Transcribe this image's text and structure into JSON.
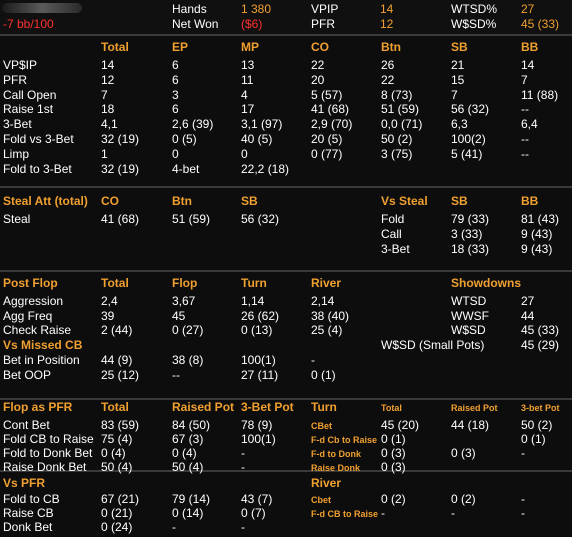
{
  "top": {
    "bb_per_100": "-7 bb/100",
    "hands_label": "Hands",
    "hands_value": "1 380",
    "netwon_label": "Net Won",
    "netwon_value": "($6)",
    "vpip_label": "VPIP",
    "vpip_value": "14",
    "pfr_label": "PFR",
    "pfr_value": "12",
    "wtsd_label": "WTSD%",
    "wtsd_value": "27",
    "wsd_label": "W$SD%",
    "wsd_value": "45 (33)"
  },
  "preflop": {
    "headers": [
      "Total",
      "EP",
      "MP",
      "CO",
      "Btn",
      "SB",
      "BB"
    ],
    "rows": [
      {
        "label": "VP$IP",
        "values": [
          "14",
          "6",
          "13",
          "22",
          "26",
          "21",
          "14"
        ]
      },
      {
        "label": "PFR",
        "values": [
          "12",
          "6",
          "11",
          "20",
          "22",
          "15",
          "7"
        ]
      },
      {
        "label": "Call Open",
        "values": [
          "7",
          "3",
          "4",
          "5 (57)",
          "8 (73)",
          "7",
          "11 (88)"
        ]
      },
      {
        "label": "Raise 1st",
        "values": [
          "18",
          "6",
          "17",
          "41 (68)",
          "51 (59)",
          "56 (32)",
          "--"
        ]
      },
      {
        "label": "3-Bet",
        "values": [
          "4,1",
          "2,6 (39)",
          "3,1 (97)",
          "2,9 (70)",
          "0,0 (71)",
          "6,3",
          "6,4"
        ]
      },
      {
        "label": "Fold vs 3-Bet",
        "values": [
          "32 (19)",
          "0 (5)",
          "40 (5)",
          "20 (5)",
          "50 (2)",
          "100(2)",
          "--"
        ]
      },
      {
        "label": "Limp",
        "values": [
          "1",
          "0",
          "0",
          "0 (77)",
          "3 (75)",
          "5 (41)",
          "--"
        ]
      },
      {
        "label": "Fold to 3-Bet",
        "values": [
          "32 (19)",
          "4-bet",
          "22,2 (18)",
          "",
          "",
          "",
          ""
        ]
      }
    ]
  },
  "steal": {
    "title": "Steal Att (total)",
    "headers": [
      "CO",
      "Btn",
      "SB"
    ],
    "row_label": "Steal",
    "row_values": [
      "41 (68)",
      "51 (59)",
      "56 (32)"
    ],
    "vs_title": "Vs Steal",
    "vs_headers": [
      "SB",
      "BB"
    ],
    "vs_rows": [
      {
        "label": "Fold",
        "values": [
          "79 (33)",
          "81 (43)"
        ]
      },
      {
        "label": "Call",
        "values": [
          "3 (33)",
          "9 (43)"
        ]
      },
      {
        "label": "3-Bet",
        "values": [
          "18 (33)",
          "9 (43)"
        ]
      }
    ]
  },
  "postflop": {
    "title": "Post Flop",
    "headers": [
      "Total",
      "Flop",
      "Turn",
      "River"
    ],
    "rows": [
      {
        "label": "Aggression",
        "values": [
          "2,4",
          "3,67",
          "1,14",
          "2,14"
        ]
      },
      {
        "label": "Agg Freq",
        "values": [
          "39",
          "45",
          "26 (62)",
          "38 (40)"
        ]
      },
      {
        "label": "Check Raise",
        "values": [
          "2 (44)",
          "0 (27)",
          "0 (13)",
          "25 (4)"
        ]
      }
    ],
    "missed_title": "Vs Missed CB",
    "missed_rows": [
      {
        "label": "Bet in Position",
        "values": [
          "44 (9)",
          "38 (8)",
          "100(1)",
          "-"
        ]
      },
      {
        "label": "Bet OOP",
        "values": [
          "25 (12)",
          "--",
          "27 (11)",
          "0 (1)"
        ]
      }
    ],
    "showdowns_title": "Showdowns",
    "showdowns": [
      {
        "label": "WTSD",
        "value": "27"
      },
      {
        "label": "WWSF",
        "value": "44"
      },
      {
        "label": "W$SD",
        "value": "45 (33)"
      },
      {
        "label": "W$SD (Small Pots)",
        "value": "45 (29)"
      }
    ]
  },
  "pfr_section": {
    "title": "Flop as PFR",
    "headers": [
      "Total",
      "Raised Pot",
      "3-Bet Pot"
    ],
    "rows": [
      {
        "label": "Cont Bet",
        "values": [
          "83 (59)",
          "84 (50)",
          "78 (9)"
        ]
      },
      {
        "label": "Fold CB to Raise",
        "values": [
          "75 (4)",
          "67 (3)",
          "100(1)"
        ]
      },
      {
        "label": "Fold to Donk Bet",
        "values": [
          "0 (4)",
          "0 (4)",
          "-"
        ]
      },
      {
        "label": "Raise Donk Bet",
        "values": [
          "50 (4)",
          "50 (4)",
          "-"
        ]
      }
    ],
    "turn_title": "Turn",
    "turn_headers": [
      "Total",
      "Raised Pot",
      "3-bet Pot"
    ],
    "turn_rows": [
      {
        "label": "CBet",
        "values": [
          "45 (20)",
          "44 (18)",
          "50 (2)"
        ]
      },
      {
        "label": "F-d Cb to Raise",
        "values": [
          "0 (1)",
          "",
          "0 (1)"
        ]
      },
      {
        "label": "F-d to Donk",
        "values": [
          "0 (3)",
          "0 (3)",
          "-"
        ]
      },
      {
        "label": "Raise Donk",
        "values": [
          "0 (3)",
          "",
          ""
        ]
      }
    ]
  },
  "vs_pfr": {
    "title": "Vs PFR",
    "rows": [
      {
        "label": "Fold to CB",
        "values": [
          "67 (21)",
          "79 (14)",
          "43 (7)"
        ]
      },
      {
        "label": "Raise CB",
        "values": [
          "0 (21)",
          "0 (14)",
          "0 (7)"
        ]
      },
      {
        "label": "Donk Bet",
        "values": [
          "0 (24)",
          "-",
          "-"
        ]
      }
    ],
    "river_title": "River",
    "river_rows": [
      {
        "label": "Cbet",
        "values": [
          "0 (2)",
          "0 (2)",
          "-"
        ]
      },
      {
        "label": "F-d CB to Raise",
        "values": [
          "-",
          "-",
          "-"
        ]
      }
    ]
  },
  "colors": {
    "accent": "#f0a030",
    "negative": "#ff3030",
    "background": "#0d0d0d"
  }
}
